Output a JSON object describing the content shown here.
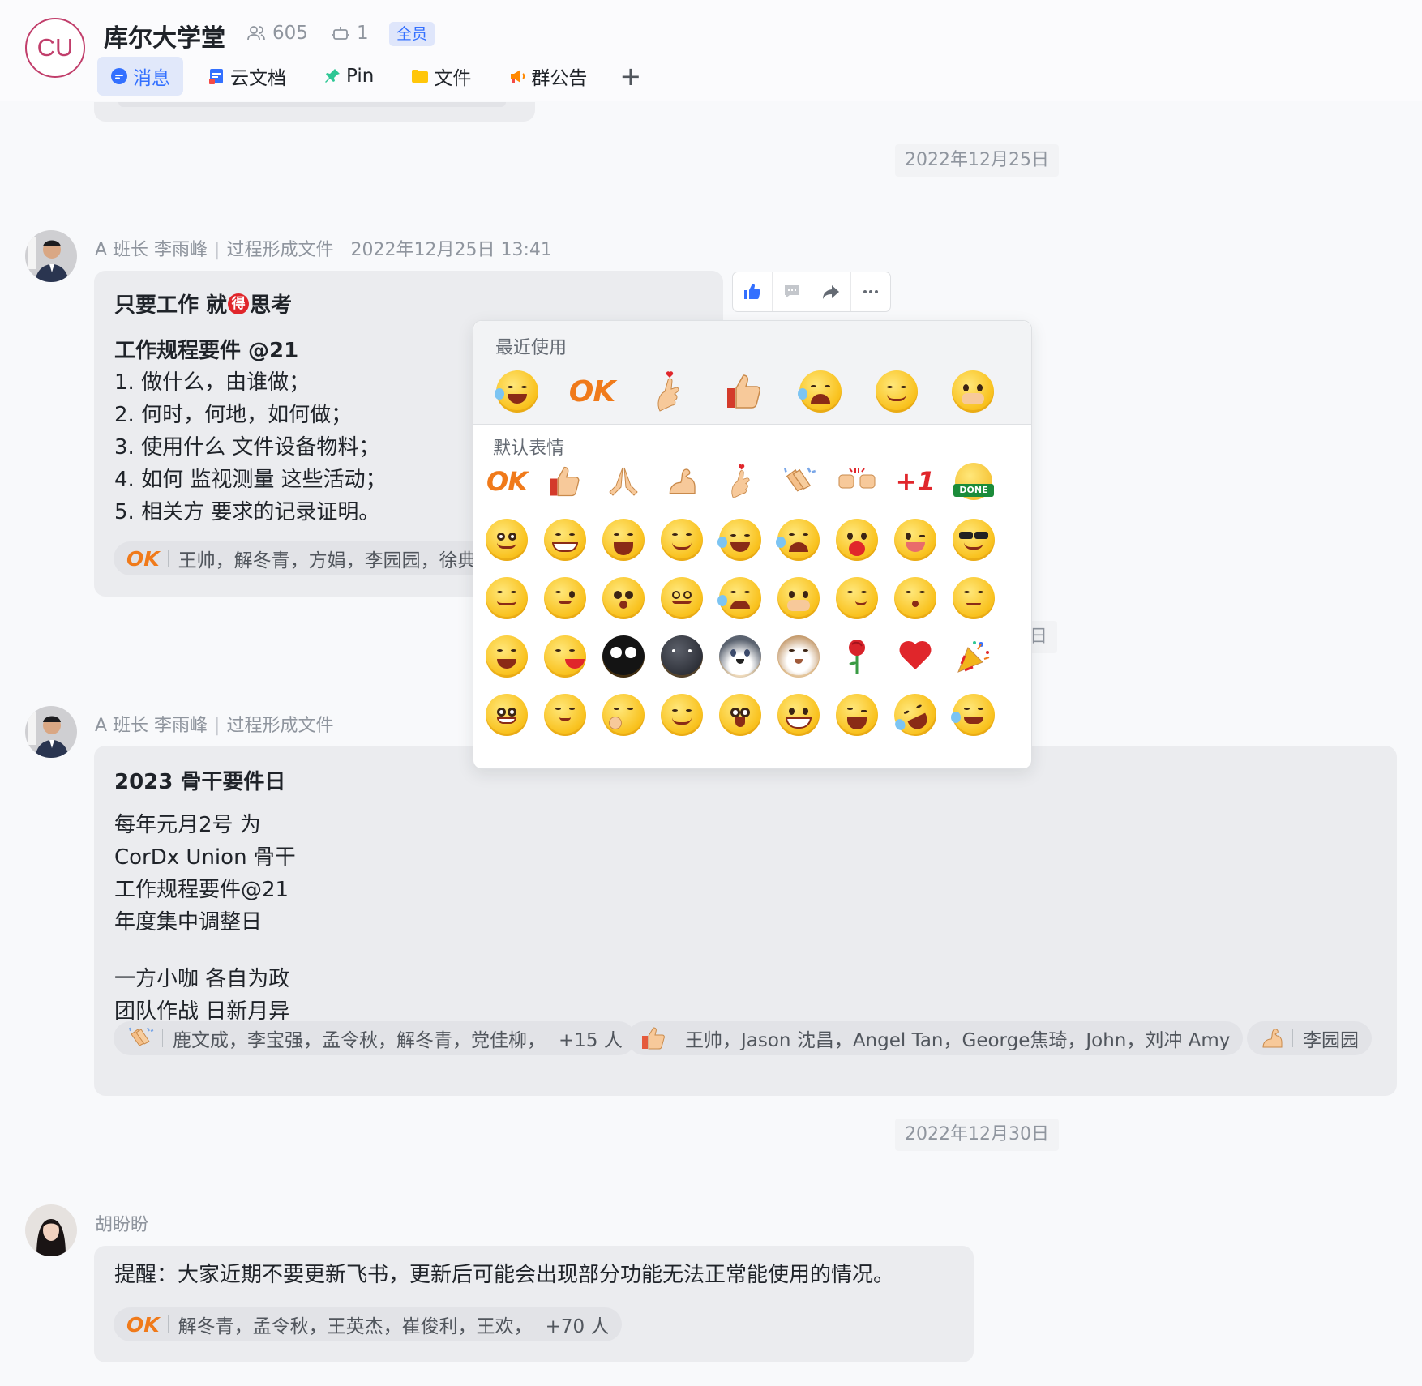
{
  "header": {
    "avatar_text": "CU",
    "group_name": "库尔大学堂",
    "member_count": "605",
    "bot_count": "1",
    "badge": "全员",
    "tabs": [
      {
        "label": "消息",
        "icon": "message-icon"
      },
      {
        "label": "云文档",
        "icon": "doc-icon"
      },
      {
        "label": "Pin",
        "icon": "pin-icon"
      },
      {
        "label": "文件",
        "icon": "folder-icon"
      },
      {
        "label": "群公告",
        "icon": "announcement-icon"
      }
    ],
    "add_tab": "+"
  },
  "dates": [
    "2022年12月25日",
    "2022年12月30日"
  ],
  "partial_date_suffix": "日",
  "messages": [
    {
      "sender": "A 班长 李雨峰",
      "tag": "过程形成文件",
      "time": "2022年12月25日 13:41",
      "title_a": "只要工作 就",
      "title_circle": "得",
      "title_b": "思考",
      "subtitle": "工作规程要件 @21",
      "lines": [
        "1. 做什么，由谁做；",
        "2. 何时，何地，如何做；",
        "3. 使用什么 文件设备物料；",
        "4. 如何 监视测量 这些活动；",
        "5. 相关方 要求的记录证明。"
      ],
      "reaction": {
        "icon": "OK",
        "users": "王帅，解冬青，方娟，李园园，徐典，"
      }
    },
    {
      "sender": "A 班长 李雨峰",
      "tag": "过程形成文件",
      "title": "2023 骨干要件日",
      "lines": [
        "每年元月2号 为",
        "CorDx Union 骨干",
        "工作规程要件@21",
        "年度集中调整日"
      ],
      "lines2": [
        "一方小咖 各自为政",
        "团队作战 日新月异"
      ],
      "reactions": [
        {
          "icon": "clap-icon",
          "users": "鹿文成，李宝强，孟令秋，解冬青，党佳柳，",
          "more": "+15 人"
        },
        {
          "icon": "thumbs-up-icon",
          "users": "王帅，Jason 沈昌，Angel Tan，George焦琦，John，刘冲 Amy"
        },
        {
          "icon": "muscle-icon",
          "users": "李园园"
        }
      ]
    },
    {
      "sender": "胡盼盼",
      "text": "提醒：大家近期不要更新飞书，更新后可能会出现部分功能无法正常能使用的情况。",
      "reaction": {
        "icon": "OK",
        "users": "解冬青，孟令秋，王英杰，崔俊利，王欢，",
        "more": "+70 人"
      }
    }
  ],
  "toolbar": [
    "thumbs-up-icon",
    "reply-icon",
    "forward-icon",
    "more-icon"
  ],
  "emoji_panel": {
    "recent_label": "最近使用",
    "default_label": "默认表情",
    "ok_text": "OK",
    "plus_one_text": "+1",
    "done_text": "DONE",
    "recent": [
      "laugh-tears-emoji",
      "ok-emoji",
      "finger-heart-emoji",
      "thumbs-up-emoji",
      "crying-emoji",
      "smile-emoji",
      "shy-emoji"
    ],
    "default_rows": [
      [
        "ok-emoji",
        "thumbs-up-emoji",
        "pray-emoji",
        "muscle-emoji",
        "finger-heart-emoji",
        "clap-emoji",
        "fist-bump-emoji",
        "plus-one-emoji",
        "done-emoji"
      ],
      [
        "smile-emoji",
        "grin-emoji",
        "laugh-emoji",
        "proud-emoji",
        "laugh-tears-emoji",
        "crying-emoji",
        "love-emoji",
        "tongue-emoji",
        "cool-emoji"
      ],
      [
        "facepalm-emoji",
        "thinking-emoji",
        "shocked-emoji",
        "dizzy-emoji",
        "sad-emoji",
        "shy-emoji",
        "smirk-emoji",
        "kiss-emoji",
        "unamused-emoji"
      ],
      [
        "slap-emoji",
        "puke-emoji",
        "black-face-emoji",
        "dark-face-emoji",
        "husky-emoji",
        "cat-emoji",
        "rose-emoji",
        "heart-emoji",
        "party-emoji"
      ],
      [
        "silly-emoji",
        "sleepy-emoji",
        "hush-emoji",
        "blush-emoji",
        "starstruck-emoji",
        "beam-emoji",
        "laughing-emoji",
        "rofl-emoji",
        "tearful-emoji"
      ]
    ]
  },
  "colors": {
    "accent": "#3370ff",
    "bubble": "#ebecef",
    "brand": "#c13e6b",
    "ok": "#f07a1a"
  }
}
